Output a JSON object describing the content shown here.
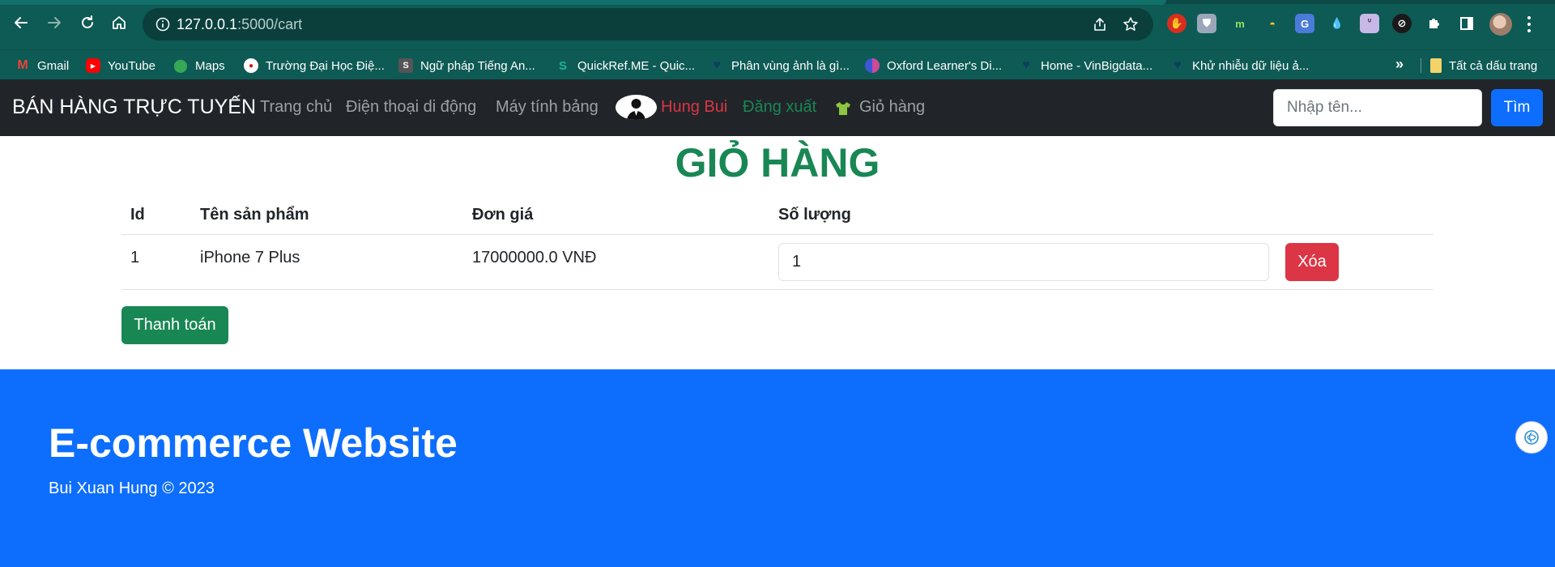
{
  "browser": {
    "url_host": "127.0.0.1",
    "url_path": ":5000/cart",
    "bookmarks": [
      {
        "label": "Gmail",
        "icon": "gmail-icon",
        "color": "#ea4335",
        "glyph": "M"
      },
      {
        "label": "YouTube",
        "icon": "youtube-icon",
        "color": "#ff0000",
        "glyph": "▶"
      },
      {
        "label": "Maps",
        "icon": "maps-icon",
        "color": "#34a853",
        "glyph": "●"
      },
      {
        "label": "Trường Đại Học Điệ...",
        "icon": "university-icon",
        "color": "#8b1d1d",
        "glyph": "•"
      },
      {
        "label": "Ngữ pháp Tiếng An...",
        "icon": "grammar-icon",
        "color": "#555555",
        "glyph": "S"
      },
      {
        "label": "QuickRef.ME - Quic...",
        "icon": "quickref-icon",
        "color": "#19b394",
        "glyph": "S"
      },
      {
        "label": "Phân vùng ảnh là gì...",
        "icon": "heart-icon",
        "color": "#0f4b66",
        "glyph": "♥"
      },
      {
        "label": "Oxford Learner's Di...",
        "icon": "oxford-icon",
        "color": "#6a3fb5",
        "glyph": "◐"
      },
      {
        "label": "Home - VinBigdata...",
        "icon": "heart-icon",
        "color": "#0f4b66",
        "glyph": "♥"
      },
      {
        "label": "Khử nhiễu dữ liệu ả...",
        "icon": "heart-icon",
        "color": "#0f4b66",
        "glyph": "♥"
      }
    ],
    "bookmarks_more": "»",
    "all_bookmarks": "Tất cả dấu trang"
  },
  "nav": {
    "brand": "BÁN HÀNG TRỰC TUYẾN",
    "home": "Trang chủ",
    "phones": "Điện thoại di động",
    "tablets": "Máy tính bảng",
    "user": "Hung Bui",
    "logout": "Đăng xuất",
    "cart": "Giỏ hàng",
    "search_placeholder": "Nhập tên...",
    "search_button": "Tìm"
  },
  "page": {
    "title": "GIỎ HÀNG"
  },
  "cart": {
    "headers": {
      "id": "Id",
      "name": "Tên sản phẩm",
      "price": "Đơn giá",
      "qty": "Số lượng"
    },
    "items": [
      {
        "id": "1",
        "name": "iPhone 7 Plus",
        "price": "17000000.0 VNĐ",
        "qty": "1",
        "delete": "Xóa"
      }
    ],
    "checkout": "Thanh toán"
  },
  "footer": {
    "title": "E-commerce Website",
    "copyright": "Bui Xuan Hung © 2023"
  },
  "colors": {
    "chrome": "#0e5a55",
    "navbar": "#212529",
    "title_green": "#198754",
    "danger": "#dc3545",
    "primary": "#0d6efd"
  }
}
